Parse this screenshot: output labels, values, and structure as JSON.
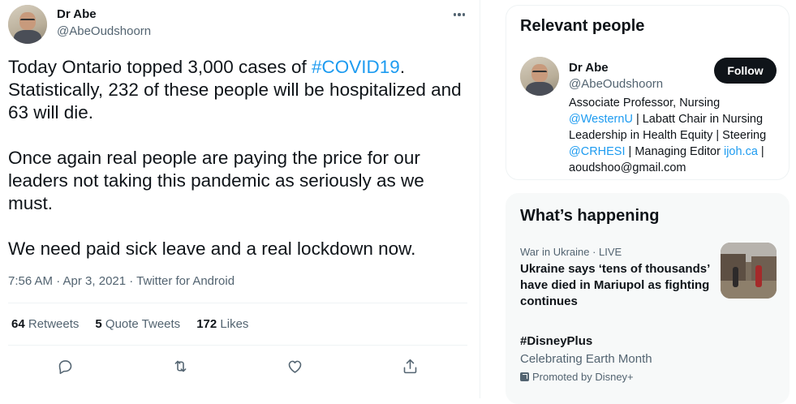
{
  "tweet": {
    "author_name": "Dr Abe",
    "author_handle": "@AbeOudshoorn",
    "more_icon": "more-horizontal-icon",
    "text_paragraph1_prefix": "Today Ontario topped 3,000 cases of ",
    "hashtag": "#COVID19",
    "text_paragraph1_suffix": ". Statistically, 232 of these people will be hospitalized and 63 will die.",
    "text_paragraph2": "Once again real people are paying the price for our leaders not taking this pandemic as seriously as we must.",
    "text_paragraph3": "We need paid sick leave and a real lockdown now.",
    "timestamp": "7:56 AM · Apr 3, 2021 · Twitter for Android",
    "stats": [
      {
        "count": "64",
        "label": "Retweets"
      },
      {
        "count": "5",
        "label": "Quote Tweets"
      },
      {
        "count": "172",
        "label": "Likes"
      }
    ],
    "actions": [
      "reply-icon",
      "retweet-icon",
      "like-icon",
      "share-icon"
    ]
  },
  "relevant_people": {
    "title": "Relevant people",
    "name": "Dr Abe",
    "handle": "@AbeOudshoorn",
    "follow_label": "Follow",
    "bio": {
      "part1": "Associate Professor, Nursing ",
      "link1": "@WesternU",
      "part2": " | Labatt Chair in Nursing Leadership in Health Equity | Steering ",
      "link2": "@CRHESI",
      "part3": " | Managing Editor ",
      "link3": "ijoh.ca",
      "part4": " | aoudshoo@gmail.com"
    }
  },
  "whats_happening": {
    "title": "What’s happening",
    "trend1": {
      "category": "War in Ukraine · LIVE",
      "headline": "Ukraine says ‘tens of thousands’ have died in Mariupol as fighting continues"
    },
    "trend2": {
      "name": "#DisneyPlus",
      "subtitle": "Celebrating Earth Month",
      "promoted": "Promoted by Disney+"
    }
  },
  "colors": {
    "accent": "#1d9bf0",
    "text": "#0f1419",
    "muted": "#536471",
    "follow_bg": "#0f1419"
  }
}
